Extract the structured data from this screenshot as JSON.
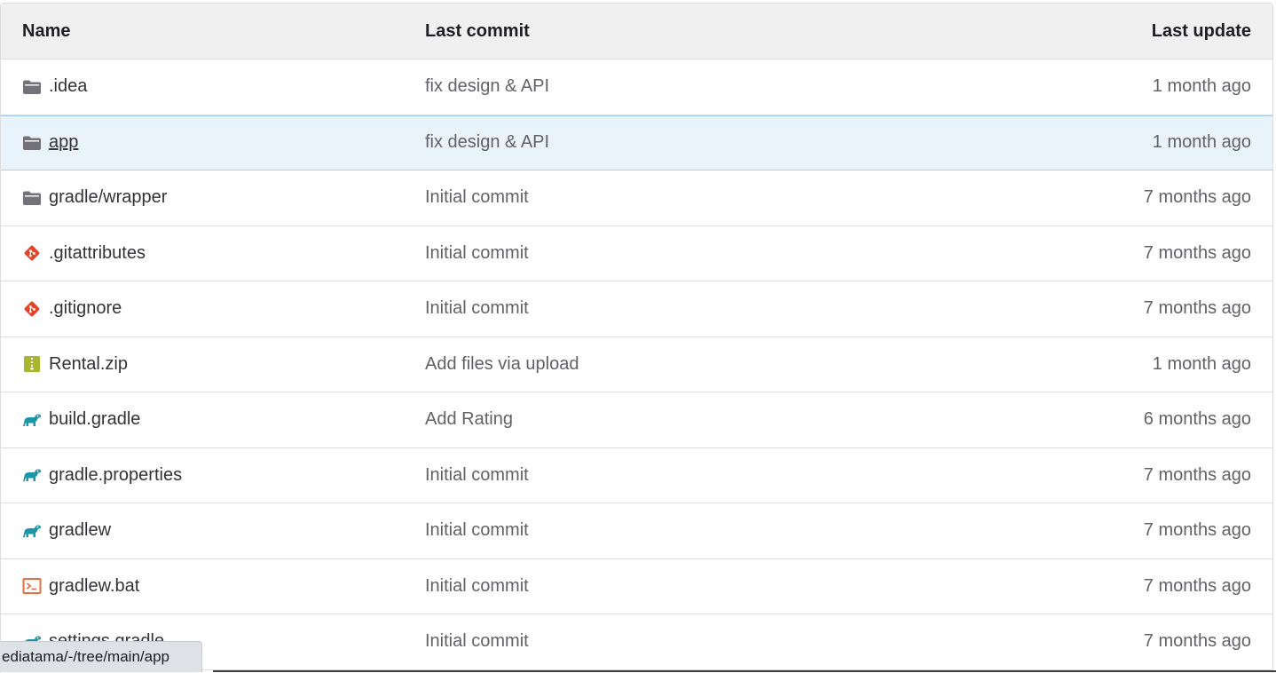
{
  "table": {
    "headers": {
      "name": "Name",
      "last_commit": "Last commit",
      "last_update": "Last update"
    },
    "rows": [
      {
        "name": ".idea",
        "icon": "folder-icon",
        "commit": "fix design & API",
        "updated": "1 month ago"
      },
      {
        "name": "app",
        "icon": "folder-icon",
        "commit": "fix design & API",
        "updated": "1 month ago"
      },
      {
        "name": "gradle/wrapper",
        "icon": "folder-icon",
        "commit": "Initial commit",
        "updated": "7 months ago"
      },
      {
        "name": ".gitattributes",
        "icon": "git-icon",
        "commit": "Initial commit",
        "updated": "7 months ago"
      },
      {
        "name": ".gitignore",
        "icon": "git-icon",
        "commit": "Initial commit",
        "updated": "7 months ago"
      },
      {
        "name": "Rental.zip",
        "icon": "zip-icon",
        "commit": "Add files via upload",
        "updated": "1 month ago"
      },
      {
        "name": "build.gradle",
        "icon": "gradle-icon",
        "commit": "Add Rating",
        "updated": "6 months ago"
      },
      {
        "name": "gradle.properties",
        "icon": "gradle-icon",
        "commit": "Initial commit",
        "updated": "7 months ago"
      },
      {
        "name": "gradlew",
        "icon": "gradle-icon",
        "commit": "Initial commit",
        "updated": "7 months ago"
      },
      {
        "name": "gradlew.bat",
        "icon": "terminal-icon",
        "commit": "Initial commit",
        "updated": "7 months ago"
      },
      {
        "name": "settings.gradle",
        "icon": "gradle-icon",
        "commit": "Initial commit",
        "updated": "7 months ago"
      }
    ]
  },
  "status_bar": {
    "url": "ediatama/-/tree/main/app"
  },
  "colors": {
    "folder": "#737278",
    "git": "#e24329",
    "zip": "#aab530",
    "gradle": "#1b97a8",
    "terminal": "#e9703e",
    "selected_row": "#e9f3fc"
  }
}
